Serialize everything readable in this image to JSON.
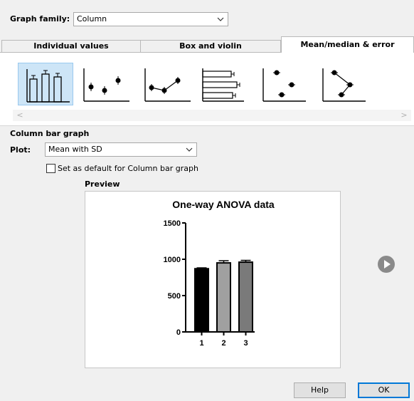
{
  "graph_family": {
    "label": "Graph family:",
    "value": "Column"
  },
  "tabs": [
    {
      "label": "Individual values"
    },
    {
      "label": "Box and violin"
    },
    {
      "label": "Mean/median & error"
    }
  ],
  "thumbnails": [
    {
      "icon": "column-bar-icon",
      "selected": true
    },
    {
      "icon": "mean-points-icon"
    },
    {
      "icon": "mean-connected-icon"
    },
    {
      "icon": "horizontal-bar-icon"
    },
    {
      "icon": "staggered-points-icon"
    },
    {
      "icon": "staggered-connected-icon"
    }
  ],
  "scroll": {
    "left": "<",
    "right": ">"
  },
  "section_title": "Column bar graph",
  "plot": {
    "label": "Plot:",
    "value": "Mean with SD"
  },
  "default_checkbox": {
    "label": "Set as default for Column bar graph",
    "checked": false
  },
  "preview": {
    "label": "Preview"
  },
  "chart_data": {
    "type": "bar",
    "title": "One-way ANOVA data",
    "categories": [
      "1",
      "2",
      "3"
    ],
    "values": [
      870,
      950,
      960
    ],
    "errors": [
      12,
      30,
      25
    ],
    "bar_colors": [
      "#000000",
      "#a0a0a0",
      "#7a7a7a"
    ],
    "ylim": [
      0,
      1500
    ],
    "yticks": [
      "0",
      "500",
      "1000",
      "1500"
    ],
    "xlabel": "",
    "ylabel": ""
  },
  "buttons": {
    "help": "Help",
    "ok": "OK"
  },
  "colors": {
    "accent": "#0078d7",
    "selected_bg": "#cde5f7"
  }
}
